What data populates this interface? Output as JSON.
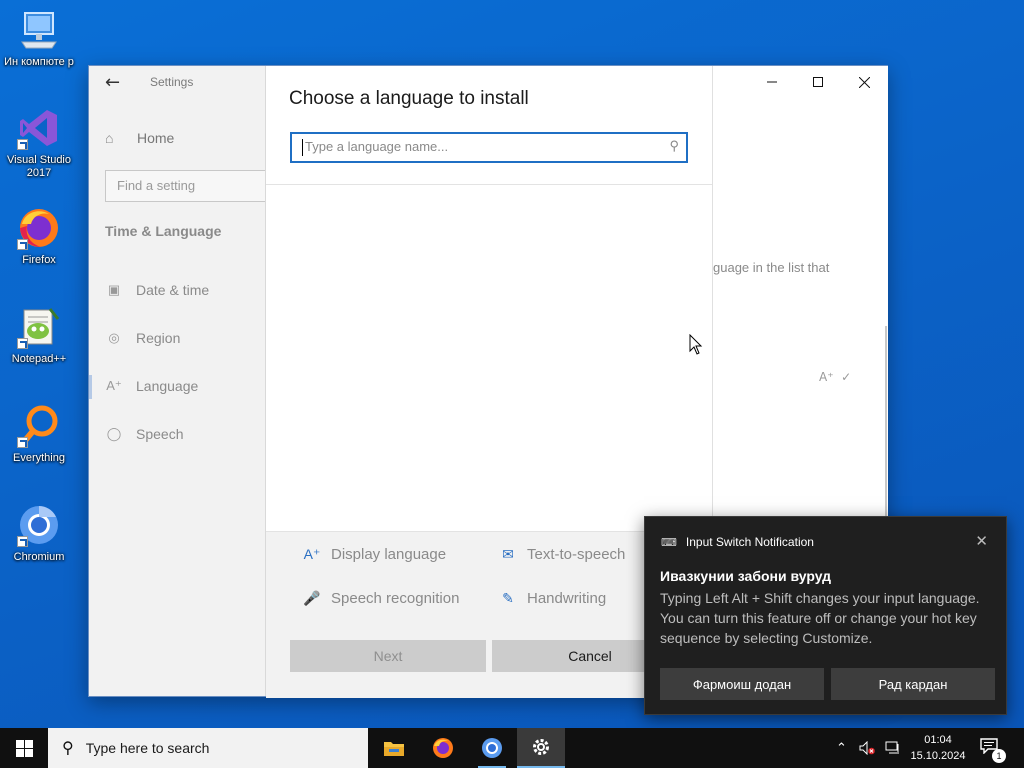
{
  "desktop": {
    "icons": [
      {
        "label": "Ин компюте р"
      },
      {
        "label": "Visual Studio 2017"
      },
      {
        "label": "Firefox"
      },
      {
        "label": "Notepad++"
      },
      {
        "label": "Everything"
      },
      {
        "label": "Chromium"
      }
    ]
  },
  "settings": {
    "app_title": "Settings",
    "sidebar": {
      "home_label": "Home",
      "search_placeholder": "Find a setting",
      "section_title": "Time & Language",
      "items": [
        {
          "label": "Date & time",
          "icon": "calendar-icon"
        },
        {
          "label": "Region",
          "icon": "globe-icon"
        },
        {
          "label": "Language",
          "icon": "language-icon"
        },
        {
          "label": "Speech",
          "icon": "microphone-icon"
        }
      ]
    },
    "right_pane": {
      "partial_text": "guage in the list that"
    },
    "dialog": {
      "title": "Choose a language to install",
      "search_placeholder": "Type a language name...",
      "features": [
        {
          "label": "Display language",
          "icon": "display-language-icon"
        },
        {
          "label": "Text-to-speech",
          "icon": "text-to-speech-icon"
        },
        {
          "label": "Speech recognition",
          "icon": "microphone-icon"
        },
        {
          "label": "Handwriting",
          "icon": "handwriting-icon"
        }
      ],
      "next_label": "Next",
      "cancel_label": "Cancel"
    }
  },
  "notification": {
    "app_name": "Input Switch Notification",
    "title": "Ивазкунии забони вуруд",
    "body": "Typing Left Alt + Shift changes your input language. You can turn this feature off or change your hot key sequence by selecting Customize.",
    "button_customize": "Фармоиш додан",
    "button_dismiss": "Рад кардан"
  },
  "taskbar": {
    "search_placeholder": "Type here to search",
    "apps": [
      "file-explorer-icon",
      "firefox-icon",
      "chromium-icon",
      "settings-icon"
    ],
    "time": "01:04",
    "date": "15.10.2024",
    "notification_count": "1"
  },
  "colors": {
    "accent": "#1f6fc4",
    "desktop": "#0b63c8",
    "taskbar": "#101010",
    "toast": "#1f1f1f"
  }
}
